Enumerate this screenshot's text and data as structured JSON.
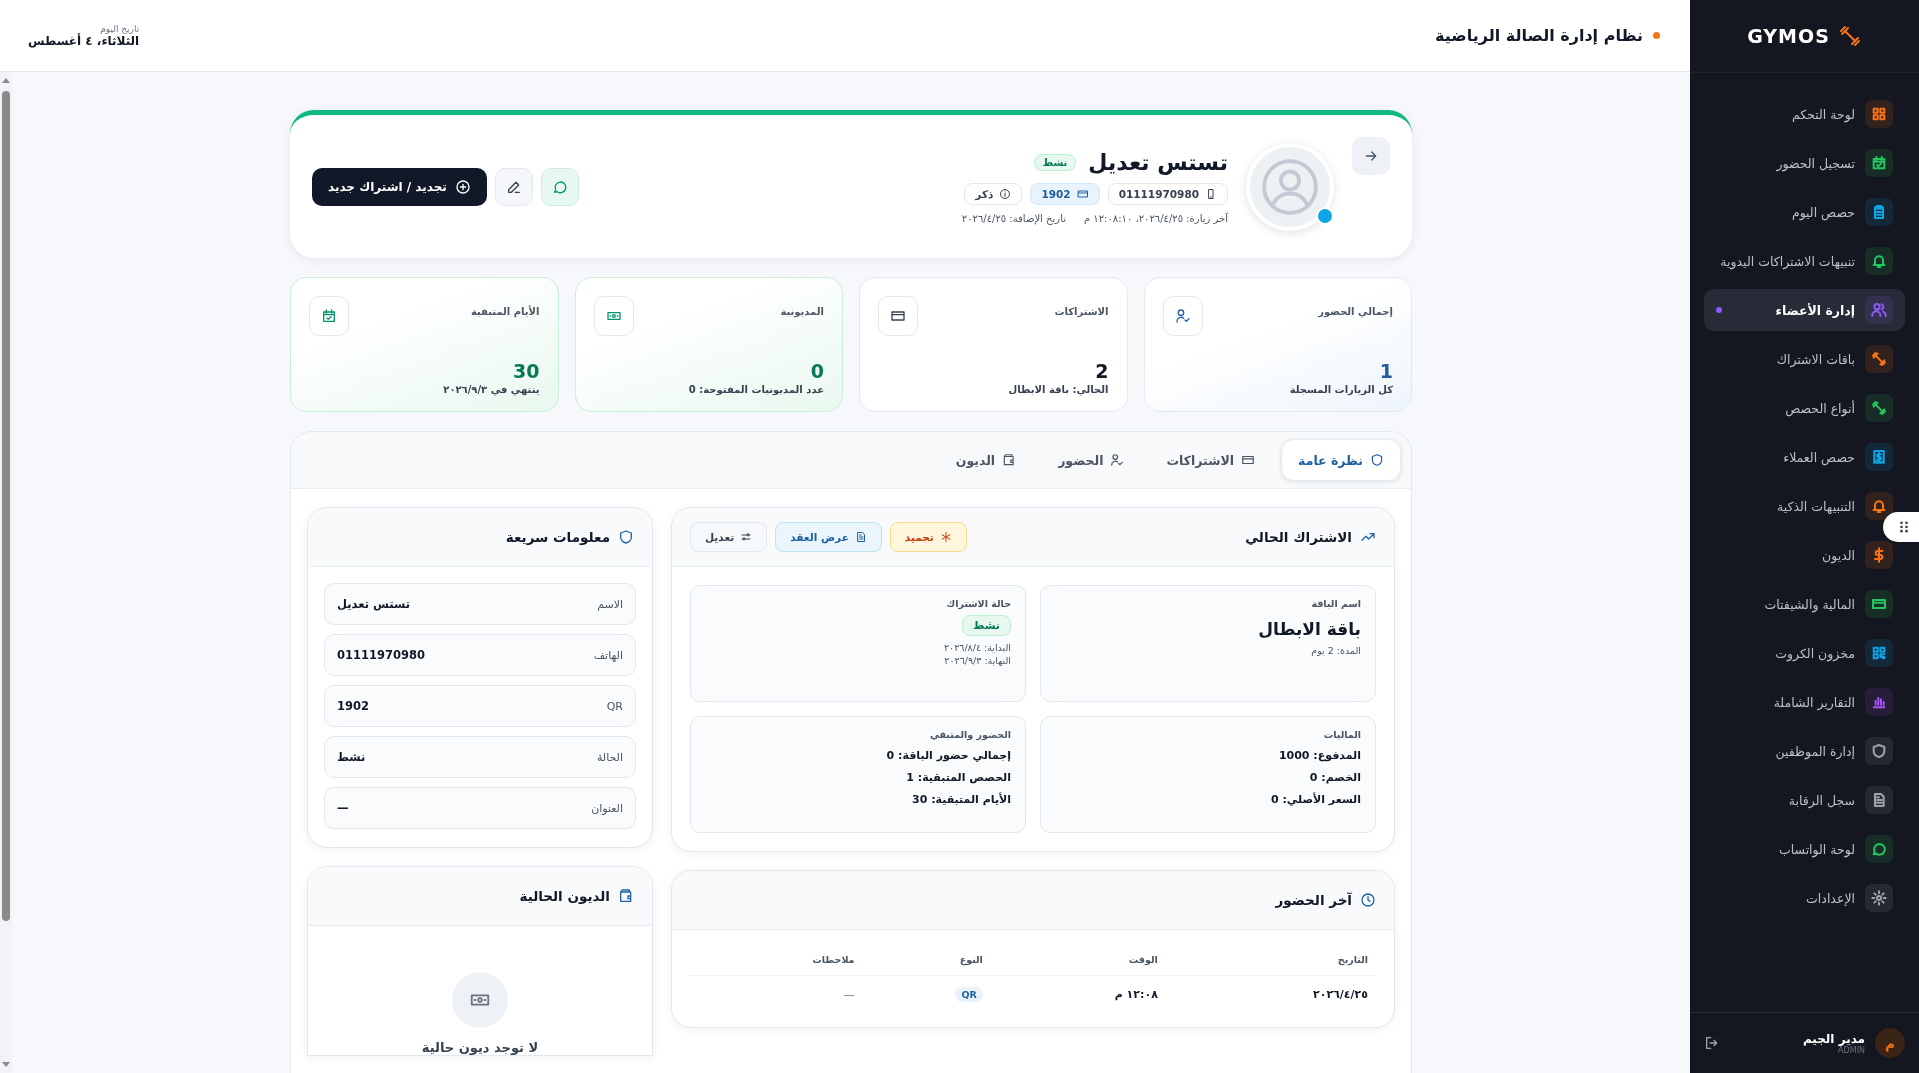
{
  "sidebar": {
    "brand": "GYMOS",
    "items": [
      {
        "label": "لوحة التحكم",
        "selected": false,
        "color": "#f97316"
      },
      {
        "label": "تسجيل الحضور",
        "selected": false,
        "color": "#22c55e"
      },
      {
        "label": "حصص اليوم",
        "selected": false,
        "color": "#0ea5e9"
      },
      {
        "label": "تنبيهات الاشتراكات اليدوية",
        "selected": false,
        "color": "#22c55e"
      },
      {
        "label": "إدارة الأعضاء",
        "selected": true,
        "color": "#8b5cf6"
      },
      {
        "label": "باقات الاشتراك",
        "selected": false,
        "color": "#f97316"
      },
      {
        "label": "أنواع الحصص",
        "selected": false,
        "color": "#22c55e"
      },
      {
        "label": "حصص العملاء",
        "selected": false,
        "color": "#0ea5e9"
      },
      {
        "label": "التنبيهات الذكية",
        "selected": false,
        "color": "#f97316"
      },
      {
        "label": "الديون",
        "selected": false,
        "color": "#f97316"
      },
      {
        "label": "المالية والشيفتات",
        "selected": false,
        "color": "#22c55e"
      },
      {
        "label": "مخزون الكروت",
        "selected": false,
        "color": "#0ea5e9"
      },
      {
        "label": "التقارير الشاملة",
        "selected": false,
        "color": "#a855f7"
      },
      {
        "label": "إدارة الموظفين",
        "selected": false,
        "color": "#9ca3af"
      },
      {
        "label": "سجل الرقابة",
        "selected": false,
        "color": "#9ca3af"
      },
      {
        "label": "لوحة الواتساب",
        "selected": false,
        "color": "#22c55e"
      },
      {
        "label": "الإعدادات",
        "selected": false,
        "color": "#9ca3af"
      }
    ],
    "user": {
      "name": "مدير الجيم",
      "role": "ADMIN",
      "initial": "م"
    }
  },
  "header": {
    "title": "نظام إدارة الصالة الرياضية",
    "date_label": "تاريخ اليوم",
    "date": "الثلاثاء، ٤ أغسطس"
  },
  "profile": {
    "name": "تستس تعديل",
    "status": "نشط",
    "phone": "01111970980",
    "qr": "1902",
    "gender": "ذكر",
    "last_visit": "آخر زيارة: ٢٠٢٦/٤/٢٥، ١٢:٠٨:١٠ م",
    "added": "تاريخ الإضافة: ٢٠٢٦/٤/٢٥",
    "renew_button": "تجديد / اشتراك جديد"
  },
  "stats": [
    {
      "label": "إجمالي الحضور",
      "value": "1",
      "sub": "كل الزيارات المسجلة",
      "kind": "blue"
    },
    {
      "label": "الاشتراكات",
      "value": "2",
      "sub": "الحالي: باقة الابطال",
      "kind": "plain"
    },
    {
      "label": "المديونية",
      "value": "0",
      "sub": "عدد المديونيات المفتوحة: 0",
      "kind": "green"
    },
    {
      "label": "الأيام المتبقية",
      "value": "30",
      "sub": "ينتهي في ٢٠٢٦/٩/٣",
      "kind": "green"
    }
  ],
  "tabs": [
    {
      "label": "نظرة عامة",
      "selected": true
    },
    {
      "label": "الاشتراكات",
      "selected": false
    },
    {
      "label": "الحضور",
      "selected": false
    },
    {
      "label": "الديون",
      "selected": false
    }
  ],
  "subscription": {
    "title": "الاشتراك الحالي",
    "actions": [
      {
        "label": "تجميد",
        "kind": "freeze"
      },
      {
        "label": "عرض العقد",
        "kind": "contract"
      },
      {
        "label": "تعديل",
        "kind": "edit"
      }
    ],
    "package": {
      "label": "اسم الباقة",
      "name": "باقة الابطال",
      "duration": "المدة: 2 يوم"
    },
    "status": {
      "label": "حالة الاشتراك",
      "badge": "نشط",
      "start": "البداية: ٢٠٢٦/٨/٤",
      "end": "النهاية: ٢٠٢٦/٩/٣"
    },
    "finance": {
      "label": "الماليات",
      "lines": [
        "المدفوع: 1000",
        "الخصم: 0",
        "السعر الأصلي: 0"
      ]
    },
    "attendance": {
      "label": "الحضور والمتبقي",
      "lines": [
        "إجمالي حضور الباقة: 0",
        "الحصص المتبقية: 1",
        "الأيام المتبقية: 30"
      ]
    }
  },
  "last_attendance": {
    "title": "آخر الحضور",
    "columns": [
      "التاريخ",
      "الوقت",
      "النوع",
      "ملاحظات"
    ],
    "rows": [
      {
        "date": "٢٠٢٦/٤/٢٥",
        "time": "١٢:٠٨ م",
        "type": "QR",
        "notes": "—"
      }
    ]
  },
  "quick_info": {
    "title": "معلومات سريعة",
    "rows": [
      {
        "label": "الاسم",
        "value": "تستس تعديل"
      },
      {
        "label": "الهاتف",
        "value": "01111970980"
      },
      {
        "label": "QR",
        "value": "1902"
      },
      {
        "label": "الحالة",
        "value": "نشط"
      },
      {
        "label": "العنوان",
        "value": "—"
      }
    ]
  },
  "debts": {
    "title": "الديون الحالية",
    "empty": "لا توجد ديون حالية"
  }
}
